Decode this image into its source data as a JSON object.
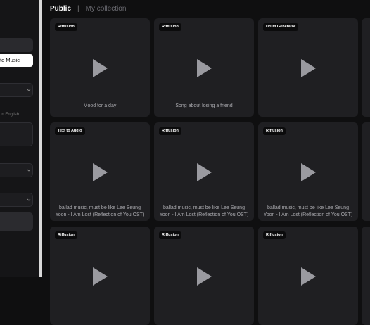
{
  "sidebar": {
    "mode_button_label": "to Music",
    "hint_text": "in English"
  },
  "tabs": {
    "public": "Public",
    "separator": "|",
    "collection": "My collection"
  },
  "cards": [
    {
      "badge": "Riffusion",
      "caption": "Mood for a day"
    },
    {
      "badge": "Riffusion",
      "caption": "Song about losing a friend"
    },
    {
      "badge": "Drum Generator",
      "caption": ""
    },
    {
      "badge": "Text to Audio",
      "caption": "ballad music, must be like Lee Seung Yoon - I Am Lost (Reflection of You OST)"
    },
    {
      "badge": "Riffusion",
      "caption": "ballad music, must be like Lee Seung Yoon - I Am Lost (Reflection of You OST)"
    },
    {
      "badge": "Riffusion",
      "caption": "ballad music, must be like Lee Seung Yoon - I Am Lost (Reflection of You OST)"
    },
    {
      "badge": "Riffusion",
      "caption": ""
    },
    {
      "badge": "Riffusion",
      "caption": ""
    },
    {
      "badge": "Riffusion",
      "caption": ""
    }
  ],
  "icons": {
    "play": "play-icon",
    "chevron": "chevron-down-icon"
  },
  "colors": {
    "background": "#0f0f10",
    "card": "#1f1f22",
    "badge_bg": "#0b0b0c",
    "play_icon": "#9a9aa0"
  }
}
